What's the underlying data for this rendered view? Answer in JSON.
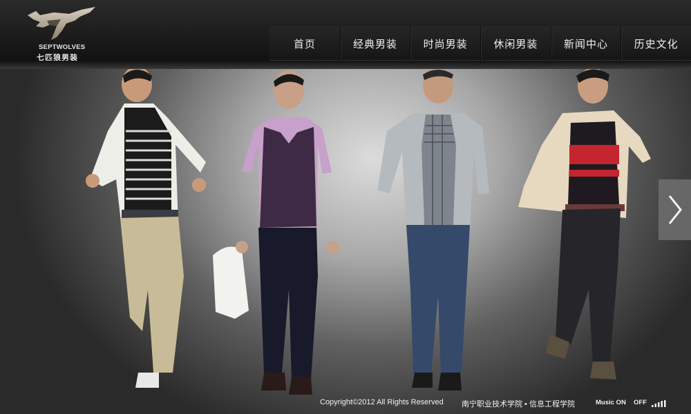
{
  "brand": {
    "name_en": "SEPTWOLVES",
    "name_cn": "七匹狼男装",
    "logo_icon": "wolf-logo-icon"
  },
  "nav": {
    "items": [
      {
        "label": "首页"
      },
      {
        "label": "经典男装"
      },
      {
        "label": "时尚男装"
      },
      {
        "label": "休闲男装"
      },
      {
        "label": "新闻中心"
      },
      {
        "label": "历史文化"
      }
    ]
  },
  "banner": {
    "next_icon": "chevron-right-icon"
  },
  "footer": {
    "copyright": "Copyright©2012 All Rights Reserved",
    "school": "南宁职业技术学院 • 信息工程学院",
    "music_on": "Music ON",
    "music_off": "OFF",
    "music_icon": "equalizer-icon"
  },
  "colors": {
    "header_bg": "#1a1a1a",
    "nav_text": "#f0f0f0",
    "stage_center": "#dcdcdc"
  }
}
